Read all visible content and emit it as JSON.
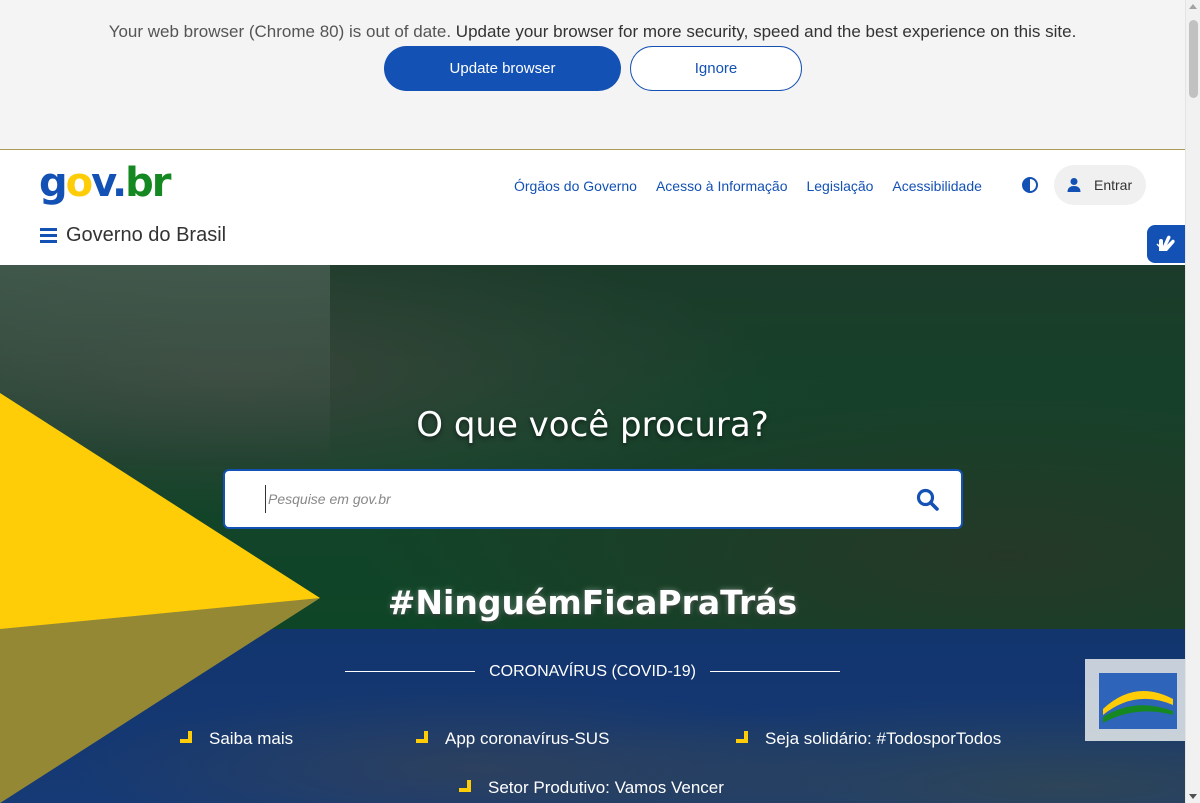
{
  "browser_banner": {
    "message_prefix": "Your web browser (Chrome 80) is out of date.",
    "message_rest": " Update your browser for more security, speed and the best experience on this site.",
    "update_label": "Update browser",
    "ignore_label": "Ignore"
  },
  "header": {
    "logo": {
      "g": "g",
      "o": "o",
      "v": "v",
      "dot": ".",
      "b": "b",
      "r": "r"
    },
    "links": [
      "Órgãos do Governo",
      "Acesso à Informação",
      "Legislação",
      "Acessibilidade"
    ],
    "login_label": "Entrar",
    "menu_title": "Governo do Brasil"
  },
  "hero": {
    "heading": "O que você procura?",
    "search_placeholder": "Pesquise em gov.br",
    "hashtag": "#NinguémFicaPraTrás"
  },
  "covid": {
    "title": "CORONAVÍRUS (COVID-19)",
    "links": [
      "Saiba mais",
      "App coronavírus-SUS",
      "Seja solidário: #TodosporTodos",
      "Setor Produtivo: Vamos Vencer"
    ]
  },
  "colors": {
    "primary_blue": "#1351b4",
    "gov_yellow": "#ffcd07",
    "gov_green": "#168821",
    "covid_band": "#12356e"
  },
  "icons": [
    "contrast-icon",
    "user-icon",
    "hamburger-menu-icon",
    "sign-language-icon",
    "search-icon",
    "bullet-marker-icon"
  ]
}
